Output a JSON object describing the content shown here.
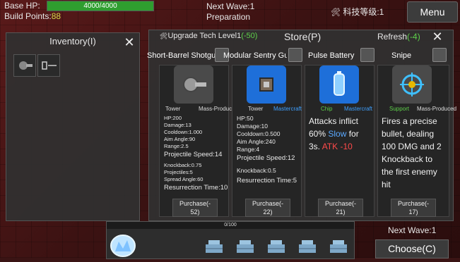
{
  "hud": {
    "base_hp_label": "Base HP:",
    "base_hp_value": "4000/4000",
    "base_hp_fraction": 1.0,
    "build_points_label": "Build Points:",
    "build_points_value": "88",
    "next_wave_top": "Next Wave:1",
    "phase": "Preparation",
    "tech_level": "科技等级:1",
    "menu_label": "Menu"
  },
  "inventory": {
    "title": "Inventory(I)",
    "close": "✕"
  },
  "store": {
    "upgrade_label": "Upgrade Tech Level1",
    "upgrade_cost": "(-50)",
    "title": "Store(P)",
    "refresh_label": "Refresh",
    "refresh_cost": "(-4)",
    "close": "✕",
    "items": [
      {
        "name": "Short-Barrel Shotgun",
        "type": "Tower",
        "production": "Mass-Produced",
        "stats_small": [
          "HP:200",
          "Damage:13",
          "Cooldown:1.000",
          "Aim Angle:90",
          "Range:2.5"
        ],
        "stat_big1": "Projectile Speed:14",
        "stats_small2": [
          "Knockback:0.75",
          "Projectiles:5",
          "Spread Angle:60"
        ],
        "stat_big2": "Resurrection Time:10",
        "purchase": "Purchase(-",
        "cost": "52)"
      },
      {
        "name": "Modular Sentry Gun",
        "type": "Tower",
        "production": "Mastercraft",
        "stats": [
          "HP:50",
          "Damage:10",
          "Cooldown:0.500",
          "Aim Angle:240",
          "Range:4"
        ],
        "stat_big1": "Projectile Speed:12",
        "stat_mid": "Knockback:0.5",
        "stat_big2": "Resurrection Time:5",
        "purchase": "Purchase(-",
        "cost": "22)"
      },
      {
        "name": "Pulse Battery",
        "type": "Chip",
        "production": "Mastercraft",
        "desc_line1": "Attacks inflict",
        "desc_pre": "60% ",
        "desc_slow": "Slow",
        "desc_post": " for",
        "desc_line3_pre": "3s. ",
        "desc_atk": "ATK -10",
        "purchase": "Purchase(-",
        "cost": "21)"
      },
      {
        "name": "Snipe",
        "type": "Support",
        "production": "Mass-Produced",
        "desc": [
          "Fires a precise",
          "bullet, dealing",
          "100 DMG and 2",
          "Knockback to",
          "the first enemy",
          "hit"
        ],
        "purchase": "Purchase(-",
        "cost": "17)"
      }
    ]
  },
  "bottom": {
    "progress_text": "0/100",
    "next_wave": "Next Wave:1",
    "choose": "Choose(C)"
  },
  "colors": {
    "green": "#5ed14a",
    "blue": "#3fa0ff",
    "red": "#ff4a4a",
    "slow": "#5aa9ff",
    "tower_icon_bg": "#4a4a4a",
    "master_icon_bg": "#1e6fd9"
  }
}
